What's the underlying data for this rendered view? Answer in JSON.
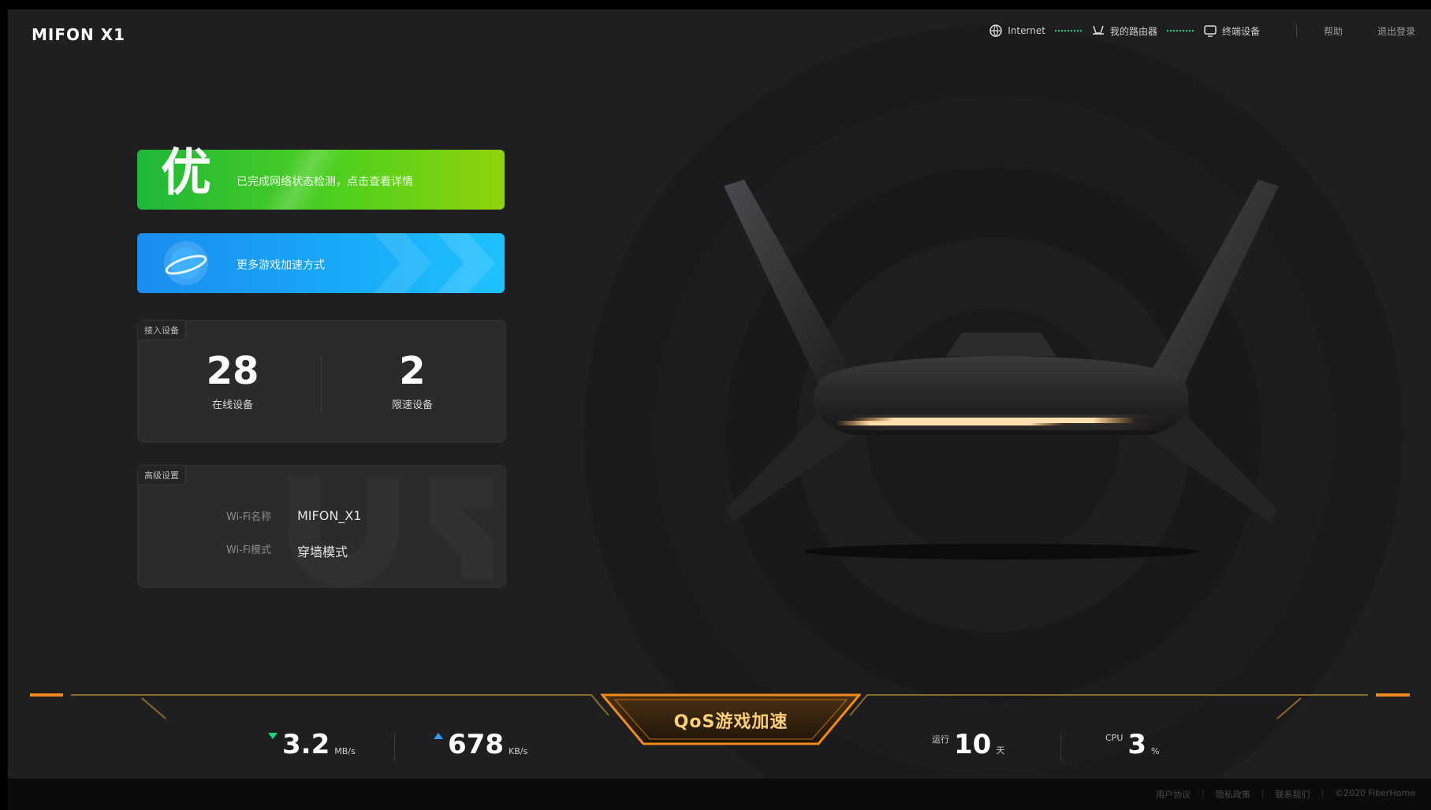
{
  "app": {
    "logo": "MIFON X1"
  },
  "topnav": {
    "internet_label": "Internet",
    "router_label": "我的路由器",
    "devices_label": "终端设备",
    "help_label": "帮助",
    "logout_label": "退出登录",
    "link_color": "#1fd88a"
  },
  "score_card": {
    "grade": "优",
    "message": "已完成网络状态检测，点击查看详情",
    "color": "#4fd01e"
  },
  "game_card": {
    "message": "更多游戏加速方式",
    "color": "#18a6f7"
  },
  "devices_panel": {
    "tag": "接入设备",
    "online_count": "28",
    "online_label": "在线设备",
    "limited_count": "2",
    "limited_label": "限速设备"
  },
  "advanced_panel": {
    "tag": "高级设置",
    "wifi_name_label": "Wi-Fi名称",
    "wifi_name_value": "MIFON_X1",
    "wifi_mode_label": "Wi-Fi模式",
    "wifi_mode_value": "穿墙模式"
  },
  "hud": {
    "qos_label": "QoS游戏加速",
    "download_value": "3.2",
    "download_unit": "MB/s",
    "upload_value": "678",
    "upload_unit": "KB/s",
    "uptime_prefix": "运行",
    "uptime_value": "10",
    "uptime_unit": "天",
    "cpu_prefix": "CPU",
    "cpu_value": "3",
    "cpu_unit": "%",
    "accent_color": "#f28a1a"
  },
  "footer": {
    "user_agreement": "用户协议",
    "privacy_policy": "隐私政策",
    "contact_us": "联系我们",
    "copyright": "©2020 FiberHome"
  }
}
